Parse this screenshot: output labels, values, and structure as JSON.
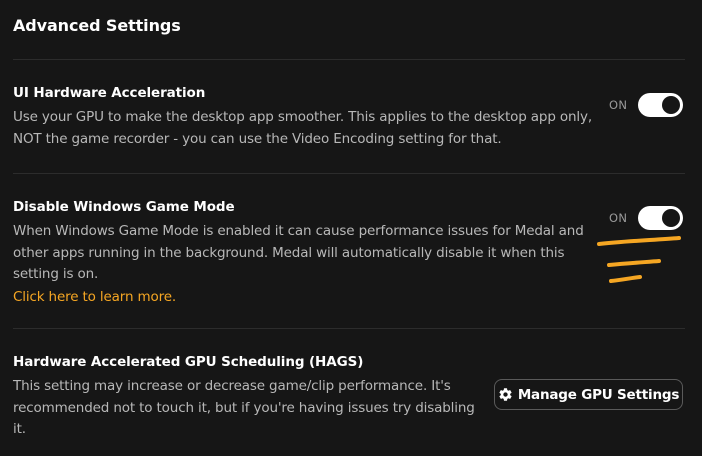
{
  "page": {
    "title": "Advanced Settings"
  },
  "settings": [
    {
      "title": "UI Hardware Acceleration",
      "description": "Use your GPU to make the desktop app smoother. This applies to the desktop app only, NOT the game recorder - you can use the Video Encoding setting for that.",
      "toggle_label": "ON",
      "toggle_on": true
    },
    {
      "title": "Disable Windows Game Mode",
      "description": "When Windows Game Mode is enabled it can cause performance issues for Medal and other apps running in the background. Medal will automatically disable it when this setting is on.",
      "link_text": "Click here to learn more.",
      "toggle_label": "ON",
      "toggle_on": true
    },
    {
      "title": "Hardware Accelerated GPU Scheduling (HAGS)",
      "description": "This setting may increase or decrease game/clip performance. It's recommended not to touch it, but if you're having issues try disabling it.",
      "button_label": "Manage GPU Settings",
      "button_icon": "gear-icon"
    }
  ],
  "colors": {
    "background": "#161616",
    "link": "#f5a623",
    "annotation": "#f5a623",
    "toggle_track": "#ffffff"
  }
}
